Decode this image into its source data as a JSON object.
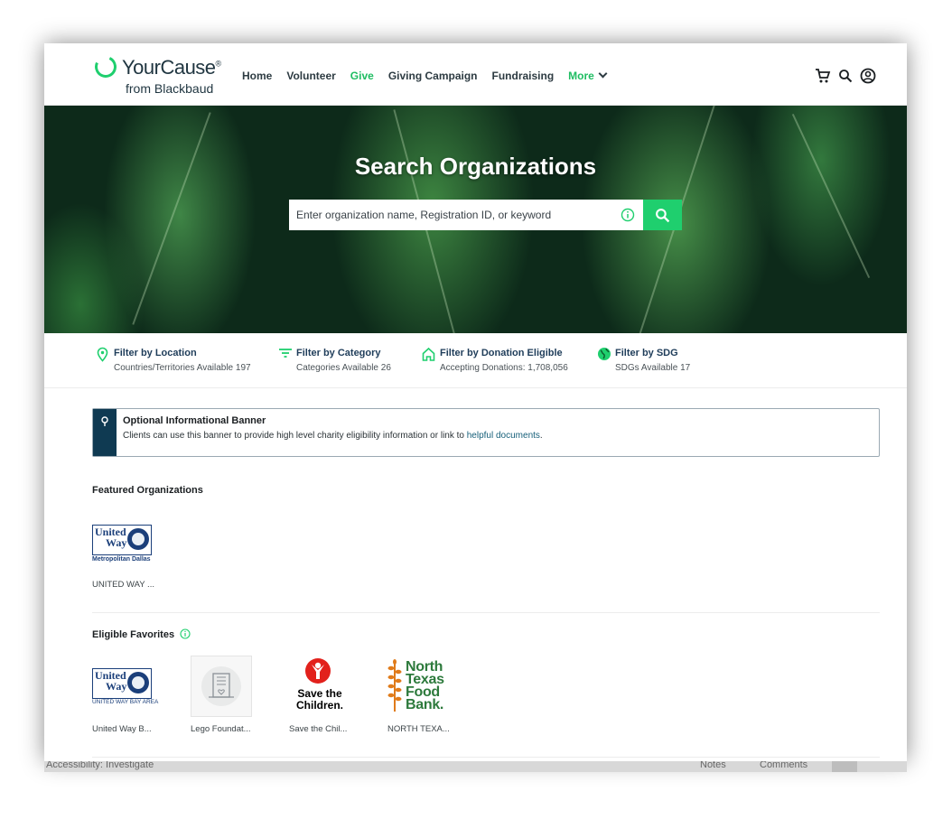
{
  "header": {
    "brand": "YourCause",
    "brand_sub": "from Blackbaud",
    "nav": [
      "Home",
      "Volunteer",
      "Give",
      "Giving Campaign",
      "Fundraising"
    ],
    "more_label": "More"
  },
  "hero": {
    "title": "Search Organizations",
    "search_placeholder": "Enter organization name, Registration ID, or keyword"
  },
  "filters": [
    {
      "title": "Filter by Location",
      "sub": "Countries/Territories Available 197"
    },
    {
      "title": "Filter by Category",
      "sub": "Categories Available 26"
    },
    {
      "title": "Filter by Donation Eligible",
      "sub": "Accepting Donations: 1,708,056"
    },
    {
      "title": "Filter by SDG",
      "sub": "SDGs Available 17"
    }
  ],
  "banner": {
    "title": "Optional Informational Banner",
    "body": "Clients can use this banner to provide high level charity eligibility information or link to ",
    "link": "helpful documents",
    "end": "."
  },
  "featured": {
    "title": "Featured Organizations",
    "orgs": [
      {
        "name": "UNITED WAY ...",
        "logo_line1": "United",
        "logo_line2": "Way",
        "logo_caption": "Metropolitan Dallas"
      }
    ]
  },
  "favorites": {
    "title": "Eligible Favorites",
    "orgs": [
      {
        "name": "United Way B...",
        "logo_line1": "United",
        "logo_line2": "Way",
        "logo_caption": "UNITED WAY BAY AREA"
      },
      {
        "name": "Lego Foundat..."
      },
      {
        "name": "Save the Chil...",
        "logo_text": "Save the Children."
      },
      {
        "name": "NORTH TEXA...",
        "logo_text": "North Texas Food Bank."
      }
    ]
  },
  "app_statusbar": {
    "accessibility": "Accessibility: Investigate",
    "notes": "Notes",
    "comments": "Comments"
  },
  "colors": {
    "accent": "#1fcf6e",
    "banner_bar": "#0f3a52",
    "link": "#17607a"
  }
}
